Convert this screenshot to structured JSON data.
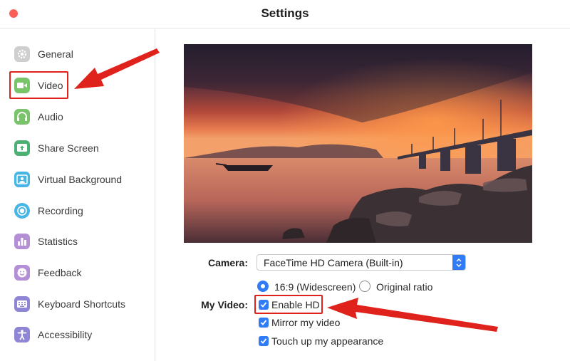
{
  "window": {
    "title": "Settings"
  },
  "sidebar": {
    "items": [
      {
        "label": "General",
        "icon": "gear-icon",
        "color": "#c9c9c9"
      },
      {
        "label": "Video",
        "icon": "video-camera-icon",
        "color": "#79c46b"
      },
      {
        "label": "Audio",
        "icon": "headphones-icon",
        "color": "#79c46b"
      },
      {
        "label": "Share Screen",
        "icon": "share-screen-icon",
        "color": "#4caf74"
      },
      {
        "label": "Virtual Background",
        "icon": "person-icon",
        "color": "#47b6e6"
      },
      {
        "label": "Recording",
        "icon": "record-icon",
        "color": "#47b6e6"
      },
      {
        "label": "Statistics",
        "icon": "bar-chart-icon",
        "color": "#b48fd6"
      },
      {
        "label": "Feedback",
        "icon": "smiley-icon",
        "color": "#b48fd6"
      },
      {
        "label": "Keyboard Shortcuts",
        "icon": "keyboard-icon",
        "color": "#8e86d4"
      },
      {
        "label": "Accessibility",
        "icon": "accessibility-icon",
        "color": "#8e86d4"
      }
    ],
    "selected": "Video"
  },
  "video": {
    "camera_label": "Camera:",
    "camera_value": "FaceTime HD Camera (Built-in)",
    "ratio_options": [
      {
        "label": "16:9 (Widescreen)",
        "selected": true
      },
      {
        "label": "Original ratio",
        "selected": false
      }
    ],
    "my_video_label": "My Video:",
    "checkboxes": [
      {
        "label": "Enable HD",
        "checked": true
      },
      {
        "label": "Mirror my video",
        "checked": true
      },
      {
        "label": "Touch up my appearance",
        "checked": true
      }
    ]
  },
  "colors": {
    "accent": "#2f7cf6",
    "annotation_red": "#e0221c",
    "close_button": "#fb5f57"
  }
}
